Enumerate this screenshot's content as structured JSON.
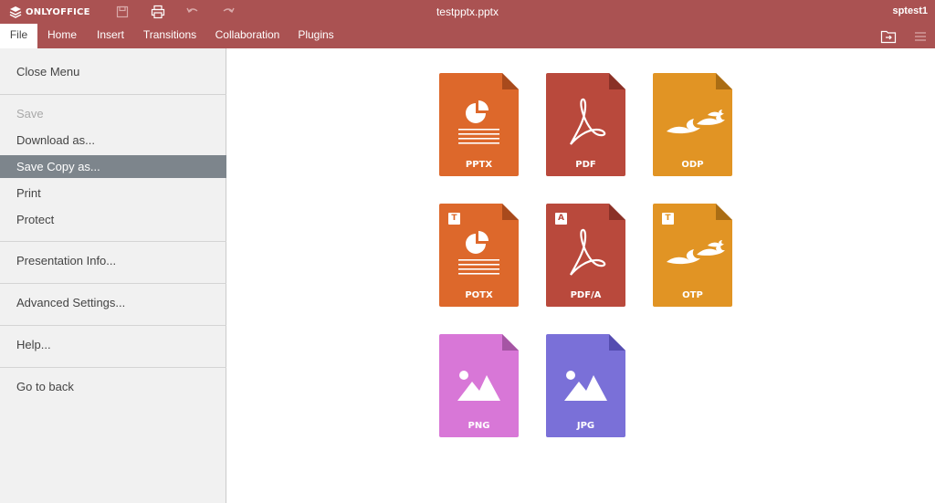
{
  "app": {
    "logo_text": "ONLYOFFICE",
    "document_title": "testpptx.pptx",
    "user": "sptest1"
  },
  "colors": {
    "header": "#aa5252",
    "pptx": "#dd682b",
    "pdf": "#b9493c",
    "odp": "#e19424",
    "png": "#d877d7",
    "jpg": "#7a70d8",
    "menu_selected": "#7d858c"
  },
  "quick_access": [
    {
      "name": "save-icon"
    },
    {
      "name": "print-icon"
    },
    {
      "name": "undo-icon"
    },
    {
      "name": "redo-icon"
    }
  ],
  "tabs": [
    {
      "label": "File",
      "active": true
    },
    {
      "label": "Home"
    },
    {
      "label": "Insert"
    },
    {
      "label": "Transitions"
    },
    {
      "label": "Collaboration"
    },
    {
      "label": "Plugins"
    }
  ],
  "toolbar_icons": [
    {
      "name": "open-file-location-icon"
    },
    {
      "name": "hamburger-menu-icon"
    }
  ],
  "menu": {
    "items": [
      {
        "label": "Close Menu"
      },
      {
        "label": "Save",
        "disabled": true
      },
      {
        "label": "Download as..."
      },
      {
        "label": "Save Copy as...",
        "selected": true
      },
      {
        "label": "Print"
      },
      {
        "label": "Protect"
      },
      {
        "label": "Presentation Info..."
      },
      {
        "label": "Advanced Settings..."
      },
      {
        "label": "Help..."
      },
      {
        "label": "Go to back"
      }
    ]
  },
  "formats": [
    {
      "label": "PPTX",
      "icon": "presentation-icon",
      "color": "#dd682b"
    },
    {
      "label": "PDF",
      "icon": "pdf-icon",
      "color": "#b9493c"
    },
    {
      "label": "ODP",
      "icon": "openoffice-birds-icon",
      "color": "#e19424"
    },
    {
      "label": "POTX",
      "icon": "presentation-icon",
      "color": "#dd682b",
      "badge": "T"
    },
    {
      "label": "PDF/A",
      "icon": "pdf-icon",
      "color": "#b9493c",
      "badge": "A"
    },
    {
      "label": "OTP",
      "icon": "openoffice-birds-icon",
      "color": "#e19424",
      "badge": "T"
    },
    {
      "label": "PNG",
      "icon": "image-icon",
      "color": "#d877d7"
    },
    {
      "label": "JPG",
      "icon": "image-icon",
      "color": "#7a70d8"
    }
  ]
}
